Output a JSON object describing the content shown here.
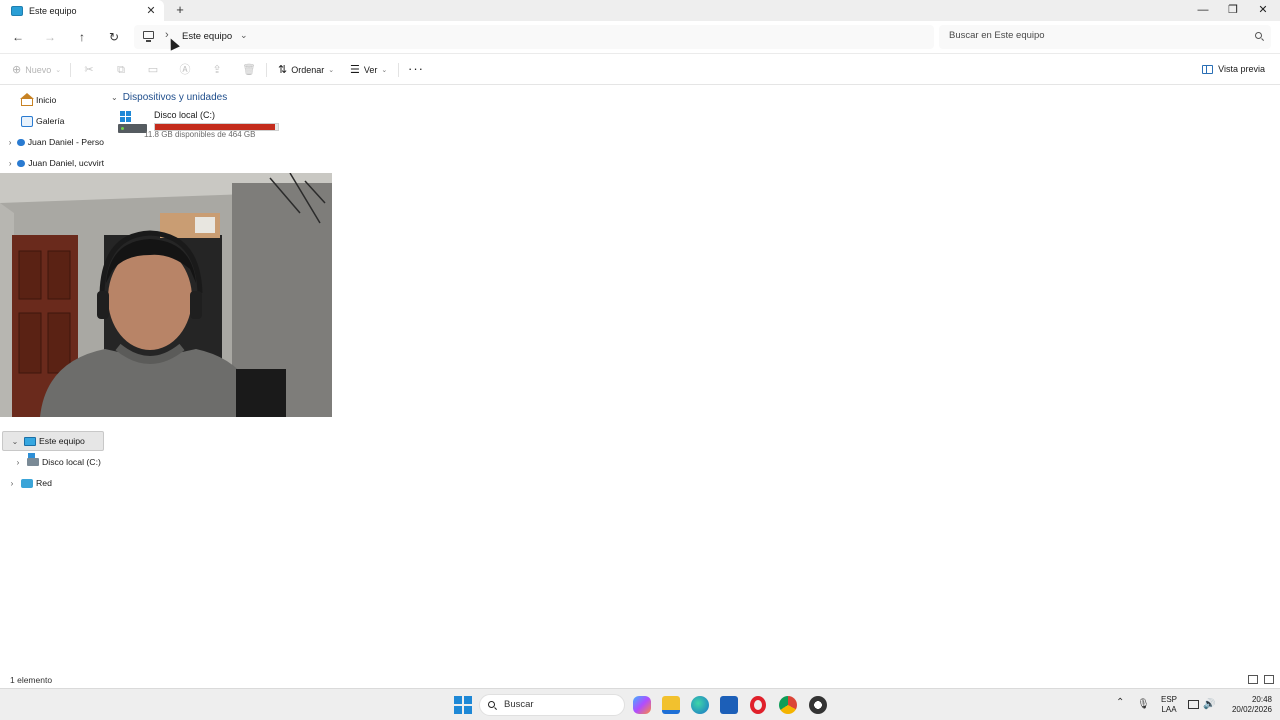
{
  "window": {
    "tab_title": "Este equipo",
    "close_tab": "✕",
    "new_tab": "+",
    "minimize": "—",
    "maximize": "❐",
    "close": "✕"
  },
  "address": {
    "back": "←",
    "forward": "→",
    "up": "↑",
    "refresh": "↻",
    "separator": "›",
    "breadcrumb": "Este equipo",
    "dropdown": "⌄",
    "search_placeholder": "Buscar en Este equipo"
  },
  "commands": {
    "new_label": "Nuevo",
    "new_glyph": "⊕",
    "cut": "✂",
    "copy": "⧉",
    "paste": "▭",
    "rename": "Ⓐ",
    "share": "⇪",
    "delete": "🗑",
    "sort_label": "Ordenar",
    "sort_glyph": "⇅",
    "view_label": "Ver",
    "view_glyph": "☰",
    "more": "···",
    "preview_label": "Vista previa",
    "chevron": "⌄"
  },
  "sidebar": {
    "items": [
      {
        "label": "Inicio",
        "expandable": false,
        "icon": "home-icon"
      },
      {
        "label": "Galería",
        "expandable": false,
        "icon": "gallery-icon"
      },
      {
        "label": "Juan Daniel - Perso",
        "expandable": true,
        "icon": "onedrive-icon"
      },
      {
        "label": "Juan Daniel, ucvvirt",
        "expandable": true,
        "icon": "onedrive-icon"
      },
      {
        "label": "Este equipo",
        "expandable": true,
        "expanded": true,
        "selected": true,
        "icon": "pc-icon"
      },
      {
        "label": "Disco local (C:)",
        "expandable": true,
        "icon": "drive-icon"
      },
      {
        "label": "Red",
        "expandable": true,
        "icon": "network-icon"
      }
    ],
    "expand_glyph": "›",
    "expanded_glyph": "⌄"
  },
  "main": {
    "group_title": "Dispositivos y unidades",
    "group_chevron": "⌄",
    "drive": {
      "name": "Disco local (C:)",
      "free_text": "11.8 GB disponibles de 464 GB",
      "used_fraction": 0.975,
      "bar_color": "#c42b1c"
    }
  },
  "status": {
    "count": "1 elemento"
  },
  "taskbar": {
    "search_placeholder": "Buscar",
    "lang_top": "ESP",
    "lang_bottom": "LAA",
    "time": "20:48",
    "date": "20/02/2026",
    "tray_expand": "⌃",
    "mic": "🎙",
    "volume": "🔊"
  },
  "colors": {
    "accent": "#1f4e8c",
    "drive_fill": "#c42b1c",
    "windows_blue": "#1e88d6"
  }
}
